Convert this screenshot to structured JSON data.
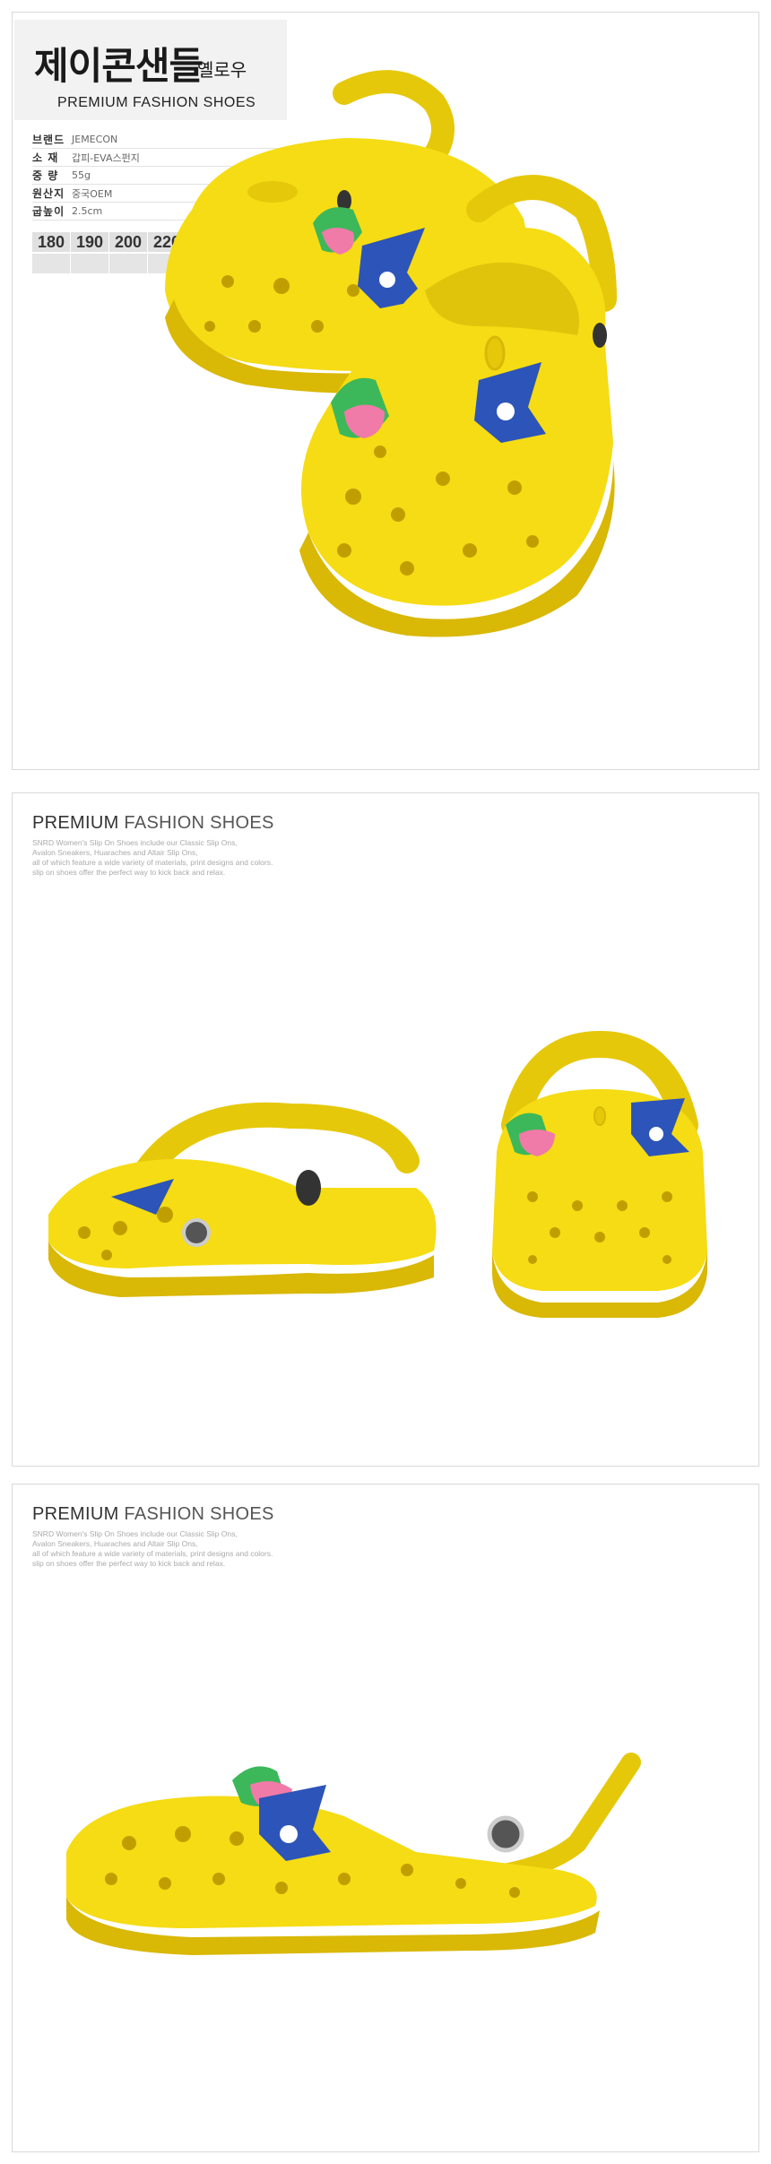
{
  "product": {
    "title": "제이콘샌들",
    "color": "옐로우",
    "subtitle": "PREMIUM FASHION SHOES"
  },
  "specs": [
    {
      "label": "브랜드",
      "value": "JEMECON"
    },
    {
      "label": "소 재",
      "value": "갑피-EVA스펀지"
    },
    {
      "label": "중 량",
      "value": "55g"
    },
    {
      "label": "원산지",
      "value": "중국OEM"
    },
    {
      "label": "굽높이",
      "value": "2.5cm"
    }
  ],
  "sizes": [
    "180",
    "190",
    "200",
    "220"
  ],
  "sections": [
    {
      "title_a": "PREMIUM",
      "title_b": " FASHION SHOES",
      "desc": [
        "SNRD Women's Slip On Shoes include our Classic Slip Ons,",
        "Avalon Sneakers, Huaraches and Altair Slip Ons,",
        "all of which feature a wide variety of materials, print designs and colors.",
        "slip on shoes offer the perfect way to kick back and relax."
      ]
    },
    {
      "title_a": "PREMIUM",
      "title_b": " FASHION SHOES",
      "desc": [
        "SNRD Women's Slip On Shoes include our Classic Slip Ons,",
        "Avalon Sneakers, Huaraches and Altair Slip Ons,",
        "all of which feature a wide variety of materials, print designs and colors.",
        "slip on shoes offer the perfect way to kick back and relax."
      ]
    }
  ],
  "colors": {
    "shoe_yellow": "#f5dc14",
    "shoe_shadow": "#d9b806",
    "shoe_dark": "#c19e00",
    "charm_blue": "#2d54b8",
    "charm_pink": "#f07aa8",
    "charm_green": "#3cb85a"
  }
}
